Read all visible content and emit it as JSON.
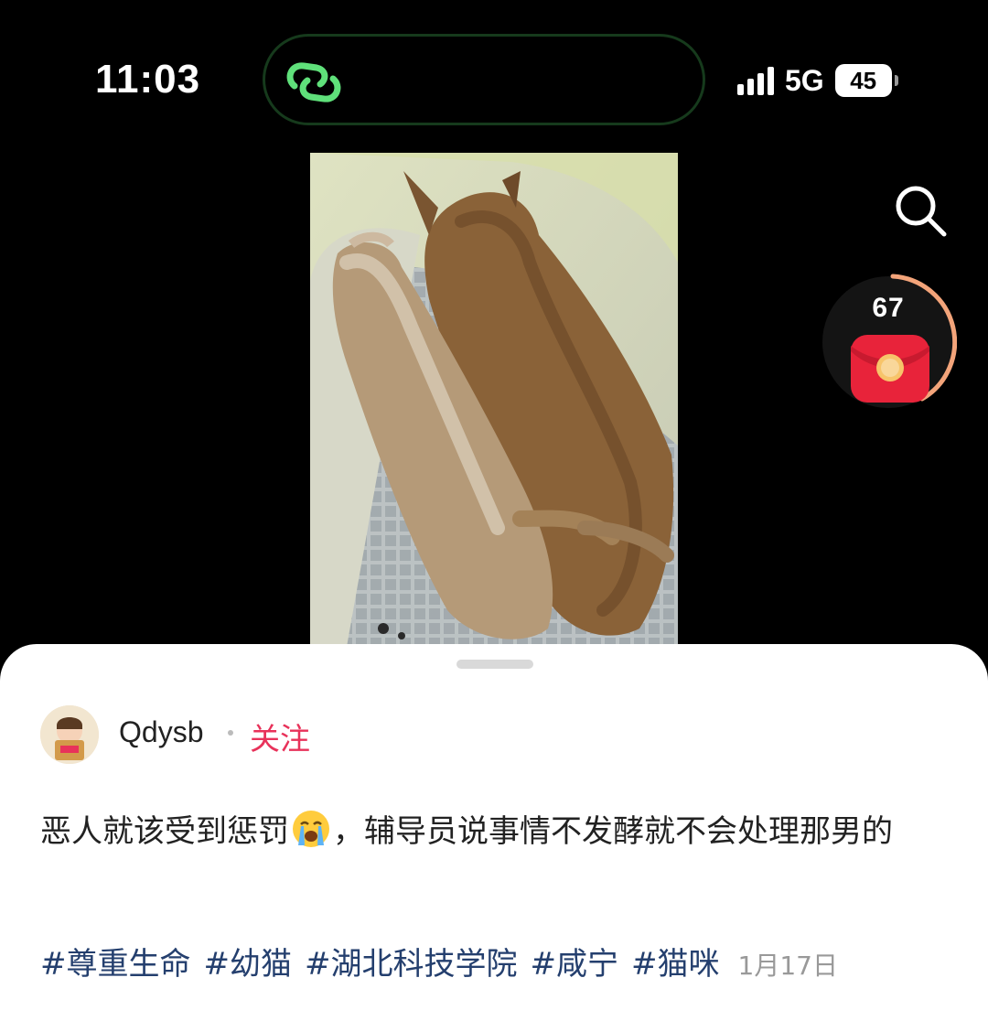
{
  "status_bar": {
    "time": "11:03",
    "network": "5G",
    "battery": "45"
  },
  "island": {
    "icon": "app-link-icon"
  },
  "overlay": {
    "search_icon": "search-icon",
    "red_packet_count": "67"
  },
  "post": {
    "author": "Qdysb",
    "follow_label": "关注",
    "text_part1": "恶人就该受到惩罚",
    "emoji": "crying-face",
    "text_part2": "，辅导员说事情不发酵就不会处理那男的",
    "tags": [
      "#尊重生命",
      "#幼猫",
      "#湖北科技学院",
      "#咸宁",
      "#猫咪"
    ],
    "date": "1月17日"
  },
  "colors": {
    "follow": "#e8325a",
    "tag": "#243f6e",
    "island_icon": "#5fe07a"
  }
}
